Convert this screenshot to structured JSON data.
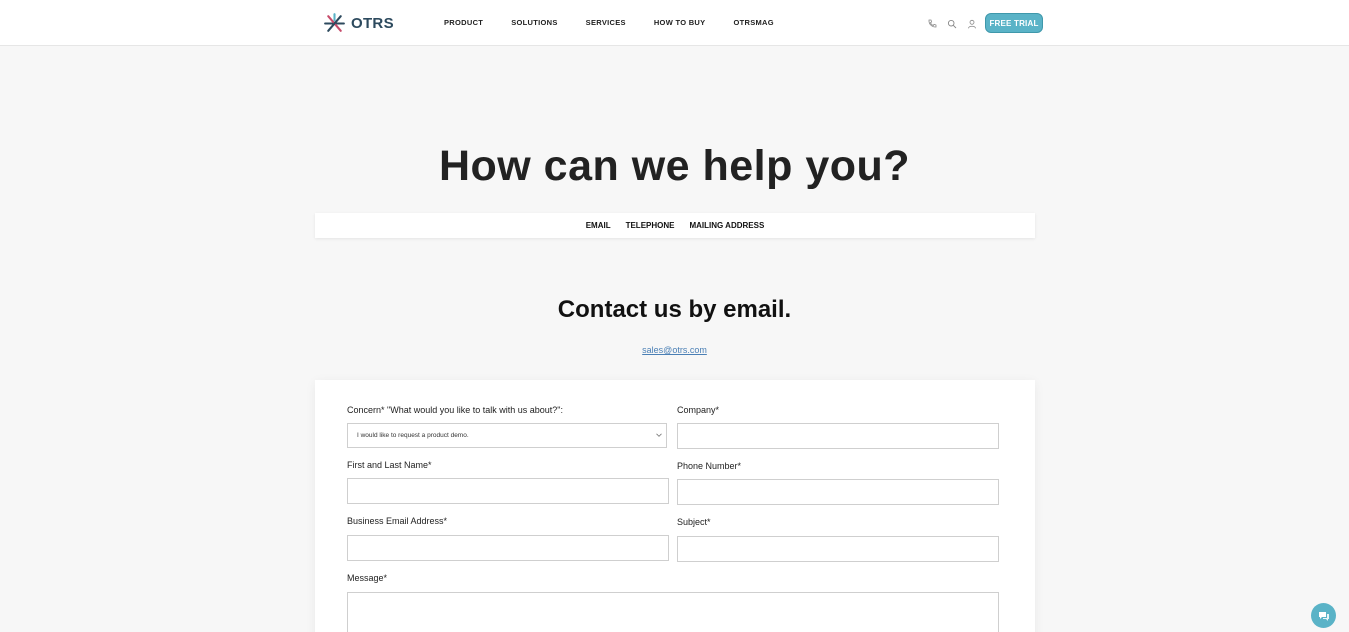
{
  "header": {
    "logo_text": "OTRS",
    "nav": [
      "PRODUCT",
      "SOLUTIONS",
      "SERVICES",
      "HOW TO BUY",
      "OTRSMAG"
    ],
    "tools": [
      "phone-icon",
      "search-icon",
      "user-icon"
    ],
    "cta_label": "FREE TRIAL"
  },
  "hero": {
    "title": "How can we help you?"
  },
  "subnav": {
    "items": [
      "EMAIL",
      "TELEPHONE",
      "MAILING ADDRESS"
    ]
  },
  "contact": {
    "title": "Contact us by email.",
    "email": "sales@otrs.com"
  },
  "form": {
    "concern_label": "Concern* \"What would you like to talk with us about?\":",
    "concern_value": "I would like to request a product demo.",
    "company_label": "Company*",
    "name_label": "First and Last Name*",
    "phone_label": "Phone Number*",
    "email_label": "Business Email Address*",
    "subject_label": "Subject*",
    "message_label": "Message*"
  },
  "colors": {
    "accent": "#5ab3c7",
    "logo_text": "#2d4a5e",
    "link": "#4a7fb5"
  },
  "widgets": {
    "chat": "chat-icon"
  }
}
